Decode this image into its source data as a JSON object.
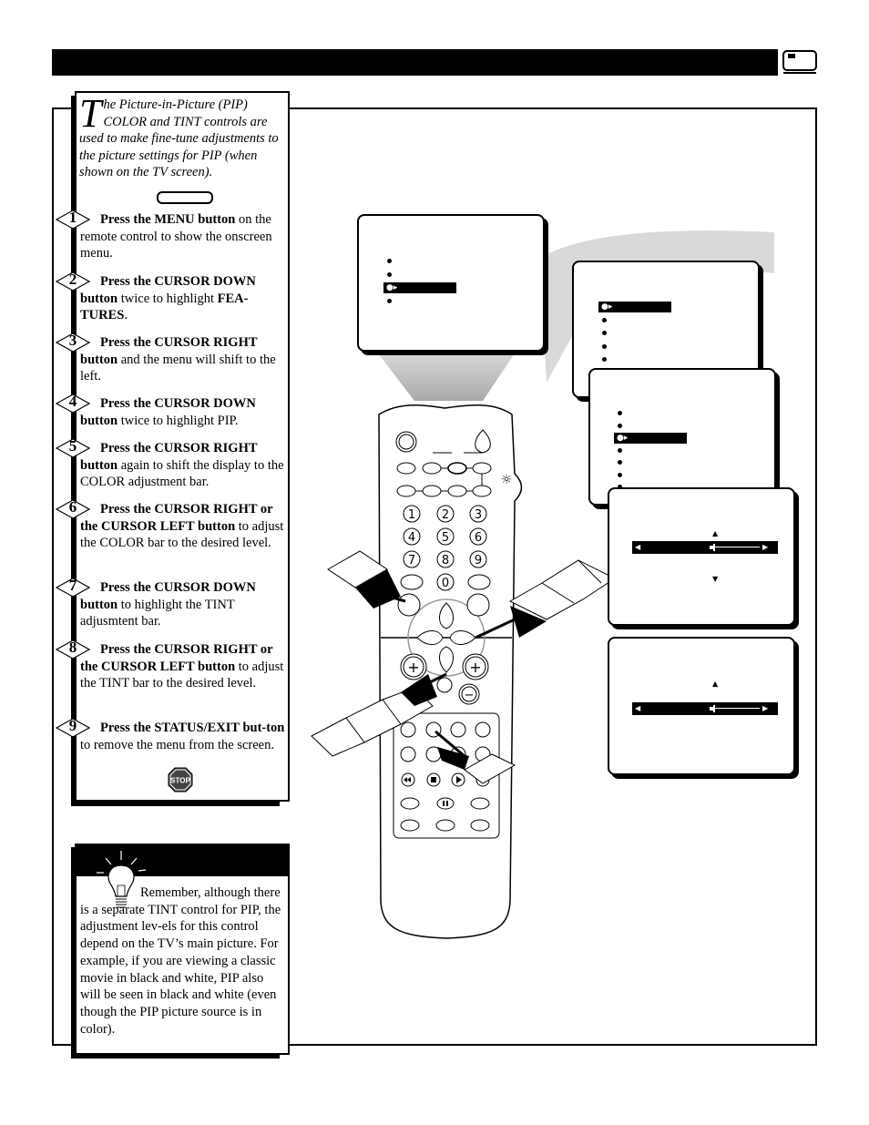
{
  "page": {
    "header_icon": "tv-screen-icon"
  },
  "intro": {
    "dropcap": "T",
    "text": "he Picture-in-Picture (PIP) COLOR and TINT controls are used to make fine-tune adjustments to the picture settings for PIP (when shown on the TV screen)."
  },
  "steps": [
    {
      "num": "1",
      "bold": "Press the MENU button",
      "rest": " on the remote control to show the onscreen menu."
    },
    {
      "num": "2",
      "bold": "Press the CURSOR DOWN button",
      "rest": " twice to highlight ",
      "bold2": "FEA-TURES",
      "rest2": "."
    },
    {
      "num": "3",
      "bold": "Press the CURSOR RIGHT button",
      "rest": " and the menu will shift to the left."
    },
    {
      "num": "4",
      "bold": "Press the CURSOR DOWN button",
      "rest": " twice to highlight PIP."
    },
    {
      "num": "5",
      "bold": "Press the CURSOR RIGHT button",
      "rest": " again to shift the display to the COLOR adjustment bar."
    },
    {
      "num": "6",
      "bold": "Press the CURSOR RIGHT or the CURSOR LEFT button",
      "rest": " to adjust the COLOR bar to the desired level."
    },
    {
      "num": "7",
      "bold": "Press the CURSOR DOWN button",
      "rest": " to highlight the TINT adjusmtent bar."
    },
    {
      "num": "8",
      "bold": "Press the CURSOR RIGHT or the CURSOR LEFT button",
      "rest": " to adjust the TINT bar to the desired level."
    },
    {
      "num": "9",
      "bold": "Press the STATUS/EXIT but-ton",
      "rest": " to remove the menu from the screen."
    }
  ],
  "stop_icon": {
    "label": "STOP"
  },
  "tip": {
    "icon": "lightbulb-icon",
    "text": "Remember, although there is a separate TINT control for PIP, the adjustment lev-els for this control depend on the TV’s main picture.  For example, if you are viewing a classic movie in black and white, PIP also will be seen in black and white (even though the PIP picture source is in color)."
  },
  "screens": {
    "main_menu": {
      "item_count": 4,
      "highlighted_index": 2
    },
    "features_menu": {
      "item_count": 5,
      "highlighted_index": 0
    },
    "pip_menu": {
      "item_count": 7,
      "highlighted_index": 2
    },
    "color_adjust": {
      "level_percent": 58
    },
    "tint_adjust": {
      "level_percent": 58
    }
  },
  "remote": {
    "number_keys": [
      "1",
      "2",
      "3",
      "4",
      "5",
      "6",
      "7",
      "8",
      "9",
      "0"
    ],
    "volume_plus": "+",
    "channel_plus": "+",
    "minus": "−",
    "transport": [
      "rewind",
      "stop",
      "play",
      "fast-forward",
      "pause"
    ]
  }
}
